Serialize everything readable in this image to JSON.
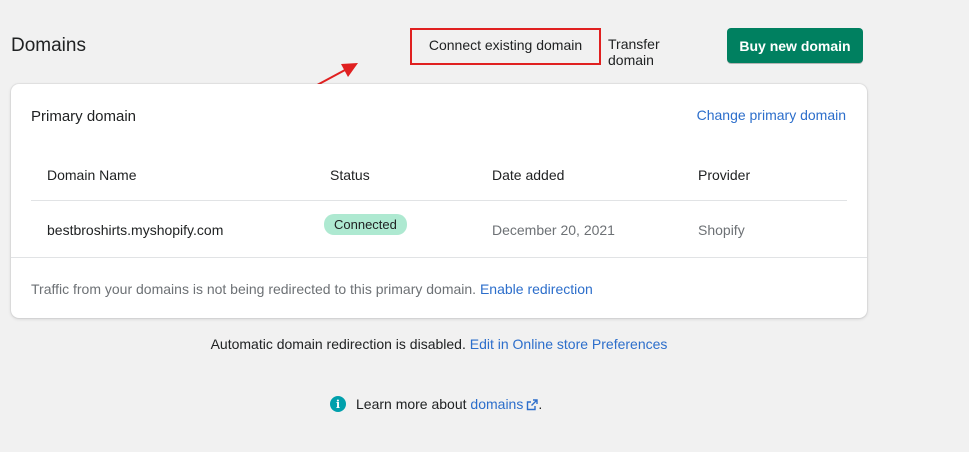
{
  "header": {
    "title": "Domains",
    "connect_label": "Connect existing domain",
    "transfer_label": "Transfer domain",
    "buy_label": "Buy new domain"
  },
  "card": {
    "title": "Primary domain",
    "change_link": "Change primary domain",
    "columns": [
      "Domain Name",
      "Status",
      "Date added",
      "Provider"
    ],
    "rows": [
      {
        "domain": "bestbroshirts.myshopify.com",
        "status": "Connected",
        "date_added": "December 20, 2021",
        "provider": "Shopify"
      }
    ],
    "footer_text": "Traffic from your domains is not being redirected to this primary domain.",
    "footer_link": "Enable redirection"
  },
  "redirection_notice": {
    "text": "Automatic domain redirection is disabled.",
    "link": "Edit in Online store Preferences"
  },
  "learn_more": {
    "text": "Learn more about",
    "link": "domains",
    "suffix": "."
  },
  "colors": {
    "primary_button": "#008060",
    "link": "#2c6ecb",
    "annotation_red": "#e02020",
    "badge_bg": "#aee9d1",
    "info_icon": "#00a0ac"
  },
  "icons": [
    "info-icon",
    "external-link-icon",
    "annotation-arrow"
  ]
}
